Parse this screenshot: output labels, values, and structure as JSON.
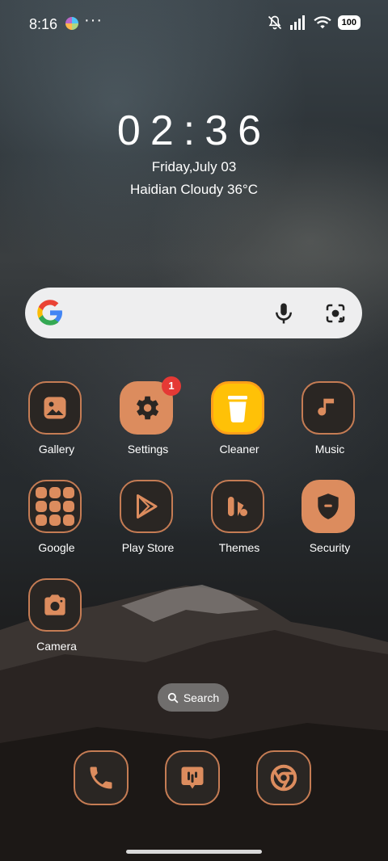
{
  "status_bar": {
    "time": "8:16",
    "overflow": "···",
    "battery": "100",
    "icons": [
      "status-app-icon",
      "mute-icon",
      "signal-icon",
      "wifi-icon",
      "battery-icon"
    ]
  },
  "clock": {
    "time": "02:36",
    "date": "Friday,July 03",
    "weather": "Haidian Cloudy 36°C"
  },
  "search_widget": {
    "icons": [
      "google-logo-icon",
      "mic-icon",
      "lens-icon"
    ]
  },
  "apps": [
    {
      "label": "Gallery",
      "icon": "gallery-icon"
    },
    {
      "label": "Settings",
      "icon": "gear-icon",
      "badge": "1"
    },
    {
      "label": "Cleaner",
      "icon": "trash-icon"
    },
    {
      "label": "Music",
      "icon": "music-note-icon"
    },
    {
      "label": "Google",
      "icon": "google-folder-icon"
    },
    {
      "label": "Play Store",
      "icon": "play-store-icon"
    },
    {
      "label": "Themes",
      "icon": "themes-icon"
    },
    {
      "label": "Security",
      "icon": "shield-icon"
    },
    {
      "label": "Camera",
      "icon": "camera-icon"
    }
  ],
  "search_pill": {
    "label": "Search"
  },
  "dock": [
    {
      "name": "phone",
      "icon": "phone-icon"
    },
    {
      "name": "messages",
      "icon": "message-icon"
    },
    {
      "name": "chrome",
      "icon": "chrome-icon"
    }
  ],
  "colors": {
    "accent": "#dc8c5e",
    "icon_border": "#c57c54",
    "badge": "#e53935",
    "cleaner": "#ffc107"
  }
}
